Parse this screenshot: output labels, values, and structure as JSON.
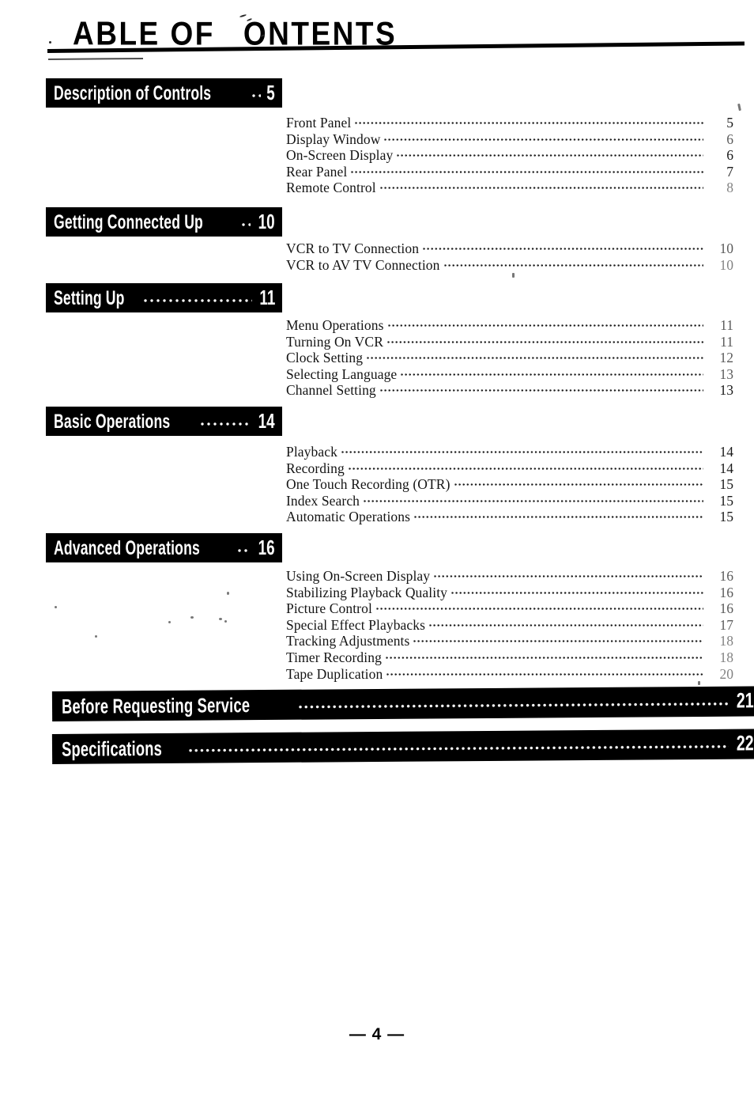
{
  "document": {
    "title": "ABLE OF      ONTENTS",
    "title_part1": "ABLE OF",
    "title_part2": "ONTENTS",
    "footer": "— 4 —"
  },
  "sections": [
    {
      "heading": "Description of Controls",
      "heading_page": "5",
      "entries": [
        {
          "label": "Front Panel",
          "page": "5"
        },
        {
          "label": "Display Window",
          "page": "6"
        },
        {
          "label": "On-Screen Display",
          "page": "6"
        },
        {
          "label": "Rear Panel",
          "page": "7"
        },
        {
          "label": "Remote Control",
          "page": "8"
        }
      ]
    },
    {
      "heading": "Getting Connected Up",
      "heading_page": "10",
      "entries": [
        {
          "label": "VCR to TV Connection",
          "page": "10"
        },
        {
          "label": "VCR to AV TV Connection",
          "page": "10"
        }
      ]
    },
    {
      "heading": "Setting Up",
      "heading_page": "11",
      "entries": [
        {
          "label": "Menu Operations",
          "page": "11"
        },
        {
          "label": "Turning On VCR",
          "page": "11"
        },
        {
          "label": "Clock Setting",
          "page": "12"
        },
        {
          "label": "Selecting Language",
          "page": "13"
        },
        {
          "label": "Channel Setting",
          "page": "13"
        }
      ]
    },
    {
      "heading": "Basic Operations",
      "heading_page": "14",
      "entries": [
        {
          "label": "Playback",
          "page": "14"
        },
        {
          "label": "Recording",
          "page": "14"
        },
        {
          "label": "One Touch Recording (OTR)",
          "page": "15"
        },
        {
          "label": "Index Search",
          "page": "15"
        },
        {
          "label": "Automatic Operations",
          "page": "15"
        }
      ]
    },
    {
      "heading": "Advanced Operations",
      "heading_page": "16",
      "entries": [
        {
          "label": "Using On-Screen Display",
          "page": "16"
        },
        {
          "label": "Stabilizing Playback Quality",
          "page": "16"
        },
        {
          "label": "Picture Control",
          "page": "16"
        },
        {
          "label": "Special Effect Playbacks",
          "page": "17"
        },
        {
          "label": "Tracking Adjustments",
          "page": "18"
        },
        {
          "label": "Timer Recording",
          "page": "18"
        },
        {
          "label": "Tape Duplication",
          "page": "20"
        }
      ]
    }
  ],
  "full_width_sections": [
    {
      "heading": "Before Requesting Service",
      "heading_page": "21"
    },
    {
      "heading": "Specifications",
      "heading_page": "22"
    }
  ]
}
